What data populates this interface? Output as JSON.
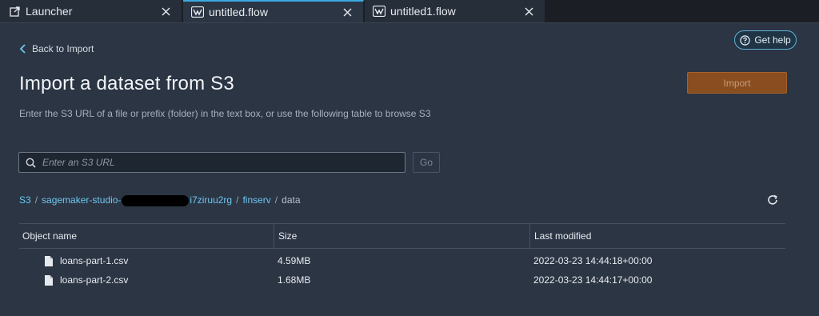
{
  "tabs": [
    {
      "label": "Launcher",
      "icon": "external-link-icon",
      "active": false
    },
    {
      "label": "untitled.flow",
      "icon": "flow-icon",
      "active": true
    },
    {
      "label": "untitled1.flow",
      "icon": "flow-icon",
      "active": false
    }
  ],
  "header": {
    "back_label": "Back to Import",
    "help_label": "Get help",
    "title": "Import a dataset from S3",
    "subtitle": "Enter the S3 URL of a file or prefix (folder) in the text box, or use the following table to browse S3",
    "import_label": "Import"
  },
  "search": {
    "placeholder": "Enter an S3 URL",
    "value": "",
    "go_label": "Go"
  },
  "breadcrumb": {
    "root": "S3",
    "bucket_prefix": "sagemaker-studio-",
    "bucket_suffix": "i7ziruu2rg",
    "folder": "finserv",
    "current": "data",
    "separator": "/"
  },
  "table": {
    "headers": [
      "Object name",
      "Size",
      "Last modified"
    ],
    "rows": [
      {
        "name": "loans-part-1.csv",
        "size": "4.59MB",
        "modified": "2022-03-23 14:44:18+00:00"
      },
      {
        "name": "loans-part-2.csv",
        "size": "1.68MB",
        "modified": "2022-03-23 14:44:17+00:00"
      }
    ]
  },
  "colors": {
    "accent": "#3aa9e0",
    "link": "#6dc6f0",
    "import_button": "#8a4d1f",
    "background": "#2b3544"
  }
}
